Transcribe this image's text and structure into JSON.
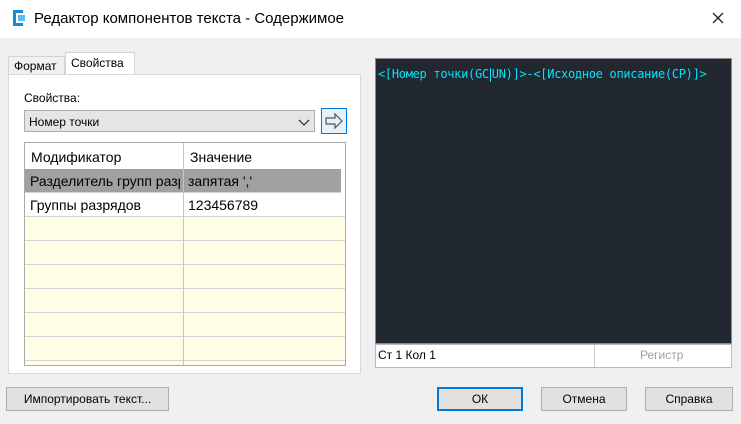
{
  "window": {
    "title": "Редактор компонентов текста - Содержимое",
    "app_icon": "civil3d-icon",
    "close_icon": "close-icon"
  },
  "tabs": [
    {
      "label": "Формат",
      "active": false
    },
    {
      "label": "Свойства",
      "active": true
    }
  ],
  "properties": {
    "label": "Свойства:",
    "selected": "Номер точки",
    "insert_icon": "insert-arrow-icon"
  },
  "grid": {
    "columns": [
      "Модификатор",
      "Значение"
    ],
    "rows": [
      {
        "modifier": "Разделитель групп разрядов",
        "value": "запятая ','",
        "selected": true
      },
      {
        "modifier": "Группы разрядов",
        "value": "123456789",
        "selected": false
      }
    ],
    "empty_rows": 6
  },
  "preview": {
    "text_before_caret": "<[Номер точки(GC",
    "text_after_caret": "UN)]>-<[Исходное описание(CP)]>",
    "background": "#212830",
    "text_color": "#00e5ff"
  },
  "status": {
    "position": "Ст 1 Кол 1",
    "case_label": "Регистр"
  },
  "buttons": {
    "import": "Импортировать текст...",
    "ok": "ОК",
    "cancel": "Отмена",
    "help": "Справка"
  },
  "colors": {
    "accent": "#0078d7",
    "selected_row": "#a0a0a0",
    "empty_row": "#fffde5"
  }
}
